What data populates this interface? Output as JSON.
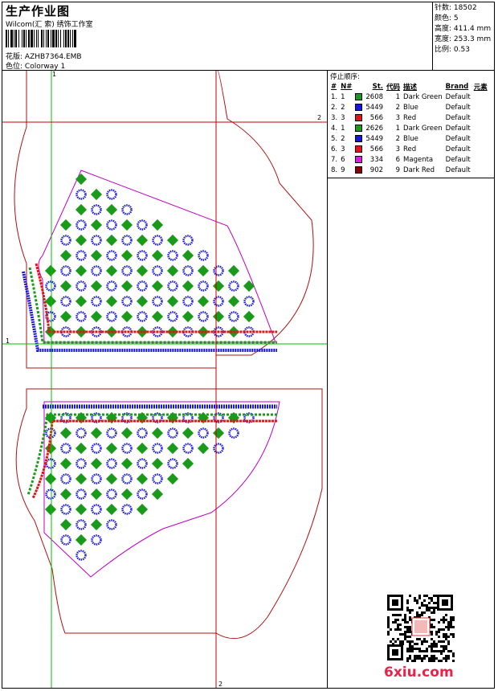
{
  "header": {
    "title": "生产作业图",
    "company": "Wilcom(汇 索) 绣饰工作室",
    "pattern_label": "花版:",
    "pattern_value": "AZHB7364.EMB",
    "colorway_label": "色位:",
    "colorway_value": "Colorway 1"
  },
  "stats": [
    {
      "label": "针数:",
      "value": "18502"
    },
    {
      "label": "颜色:",
      "value": "5"
    },
    {
      "label": "高度:",
      "value": "411.4 mm"
    },
    {
      "label": "宽度:",
      "value": "253.3 mm"
    },
    {
      "label": "比例:",
      "value": "0.53"
    }
  ],
  "stop_sequence": {
    "title": "停止顺序:",
    "headers": [
      "#",
      "N#",
      "St.",
      "代码",
      "描述",
      "Brand",
      "元素"
    ],
    "rows": [
      {
        "idx": "1.",
        "n": "1",
        "color": "#1a9a1a",
        "st": "2608",
        "code": "1",
        "desc": "Dark Green",
        "brand": "Default"
      },
      {
        "idx": "2.",
        "n": "2",
        "color": "#1515e0",
        "st": "5449",
        "code": "2",
        "desc": "Blue",
        "brand": "Default"
      },
      {
        "idx": "3.",
        "n": "3",
        "color": "#e01515",
        "st": "566",
        "code": "3",
        "desc": "Red",
        "brand": "Default"
      },
      {
        "idx": "4.",
        "n": "1",
        "color": "#1a9a1a",
        "st": "2626",
        "code": "1",
        "desc": "Dark Green",
        "brand": "Default"
      },
      {
        "idx": "5.",
        "n": "2",
        "color": "#1515e0",
        "st": "5449",
        "code": "2",
        "desc": "Blue",
        "brand": "Default"
      },
      {
        "idx": "6.",
        "n": "3",
        "color": "#e01515",
        "st": "566",
        "code": "3",
        "desc": "Red",
        "brand": "Default"
      },
      {
        "idx": "7.",
        "n": "6",
        "color": "#e815e8",
        "st": "334",
        "code": "6",
        "desc": "Magenta",
        "brand": "Default"
      },
      {
        "idx": "8.",
        "n": "9",
        "color": "#8b0000",
        "st": "902",
        "code": "9",
        "desc": "Dark Red",
        "brand": "Default"
      }
    ]
  },
  "axis_labels": {
    "top_1": "1",
    "right_2": "2",
    "left_1": "1",
    "bottom_2": "2"
  },
  "colors": {
    "guide_green": "#00c000",
    "guide_red": "#c00000",
    "outline": "#b01010",
    "cut": "#c000c0"
  },
  "watermark": "6xiu.com"
}
